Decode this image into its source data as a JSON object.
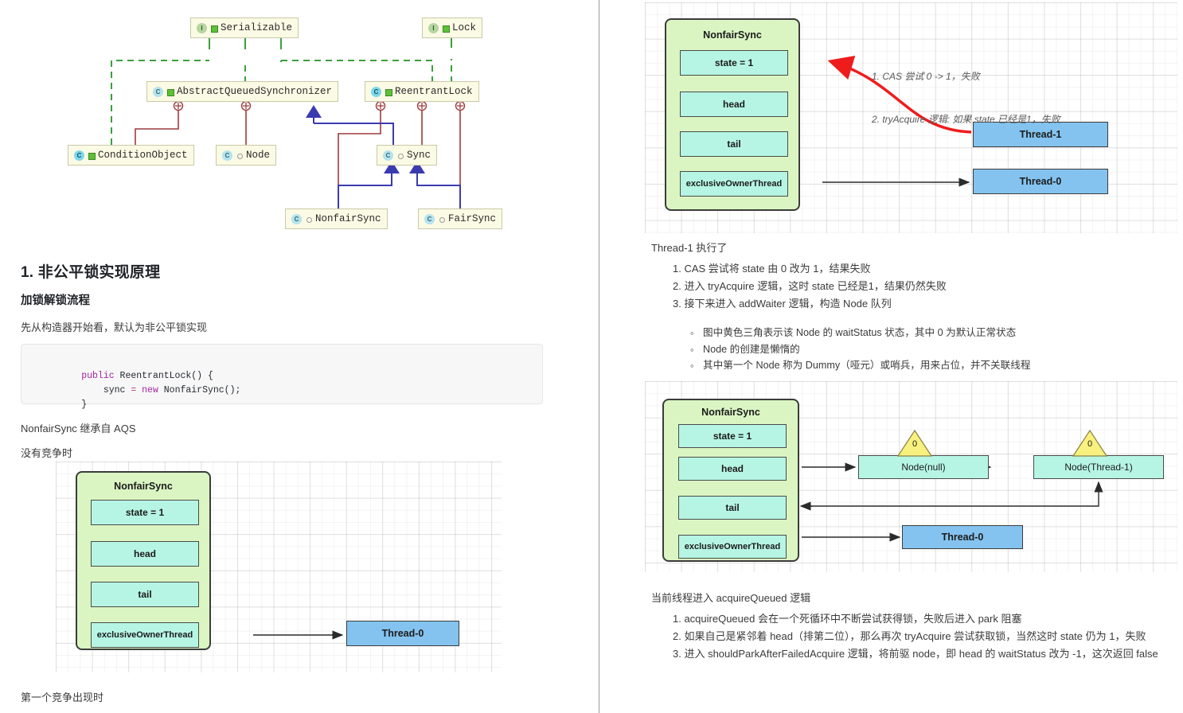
{
  "uml": {
    "nodes": [
      {
        "id": "serializable",
        "label": "Serializable",
        "kind": "interface",
        "vis": "public"
      },
      {
        "id": "lock",
        "label": "Lock",
        "kind": "interface",
        "vis": "public"
      },
      {
        "id": "aqs",
        "label": "AbstractQueuedSynchronizer",
        "kind": "abstract-class",
        "vis": "public"
      },
      {
        "id": "reentrantlock",
        "label": "ReentrantLock",
        "kind": "class",
        "vis": "public"
      },
      {
        "id": "conditionobject",
        "label": "ConditionObject",
        "kind": "class",
        "vis": "public"
      },
      {
        "id": "node",
        "label": "Node",
        "kind": "abstract-class",
        "vis": "package"
      },
      {
        "id": "sync",
        "label": "Sync",
        "kind": "abstract-class",
        "vis": "package"
      },
      {
        "id": "nonfairsync",
        "label": "NonfairSync",
        "kind": "class",
        "vis": "package"
      },
      {
        "id": "fairsync",
        "label": "FairSync",
        "kind": "class",
        "vis": "package"
      }
    ],
    "edge_colors": {
      "implements": "#3aa03a",
      "inner_class": "#9e3b3b",
      "extends": "#3b3bb0"
    }
  },
  "left": {
    "heading1": "1. 非公平锁实现原理",
    "heading2": "加锁解锁流程",
    "para1": "先从构造器开始看，默认为非公平锁实现",
    "code": {
      "line1_kw": "public",
      "line1_rest": " ReentrantLock() {",
      "line2_pre": "    sync ",
      "line2_eq": "=",
      "line2_new": " new",
      "line2_rest": " NonfairSync();",
      "line3": "}"
    },
    "para2": "NonfairSync 继承自 AQS",
    "para3": "没有竞争时",
    "para4": "第一个竞争出现时",
    "diagram": {
      "sync_title": "NonfairSync",
      "fields": [
        "state = 1",
        "head",
        "tail",
        "exclusiveOwnerThread"
      ],
      "thread0": "Thread-0"
    }
  },
  "right": {
    "diagram1": {
      "sync_title": "NonfairSync",
      "fields": [
        "state = 1",
        "head",
        "tail",
        "exclusiveOwnerThread"
      ],
      "thread1": "Thread-1",
      "thread0": "Thread-0",
      "annotation_line1": "1. CAS 尝试 0 -> 1，失败",
      "annotation_line2": "2. tryAcquire 逻辑: 如果 state 已经是1，失败"
    },
    "section1": {
      "lead": "Thread-1 执行了",
      "items": [
        "1. CAS 尝试将 state 由 0 改为 1，结果失败",
        "2. 进入 tryAcquire 逻辑，这时 state 已经是1，结果仍然失败",
        "3. 接下来进入 addWaiter 逻辑，构造 Node 队列"
      ],
      "subitems": [
        "图中黄色三角表示该 Node 的 waitStatus 状态，其中 0 为默认正常状态",
        "Node 的创建是懒惰的",
        "其中第一个 Node 称为 Dummy（哑元）或哨兵，用来占位，并不关联线程"
      ]
    },
    "diagram2": {
      "sync_title": "NonfairSync",
      "fields": [
        "state = 1",
        "head",
        "tail",
        "exclusiveOwnerThread"
      ],
      "node1": "Node(null)",
      "node2": "Node(Thread-1)",
      "wait_status_1": "0",
      "wait_status_2": "0",
      "thread0": "Thread-0"
    },
    "section2": {
      "lead": "当前线程进入 acquireQueued 逻辑",
      "items": [
        "1. acquireQueued 会在一个死循环中不断尝试获得锁，失败后进入 park 阻塞",
        "2. 如果自己是紧邻着 head（排第二位），那么再次 tryAcquire 尝试获取锁，当然这时 state 仍为 1，失败",
        "3. 进入 shouldParkAfterFailedAcquire 逻辑，将前驱 node，即 head 的 waitStatus 改为 -1，这次返回 false"
      ]
    }
  },
  "colors": {
    "sync_green": "#daf5c2",
    "field_cyan": "#b6f5e3",
    "thread_blue": "#84c3ef",
    "wait_yellow": "#f7ef7a",
    "red_arrow": "#ef1c1c",
    "uml_node_bg": "#fbfae4"
  }
}
